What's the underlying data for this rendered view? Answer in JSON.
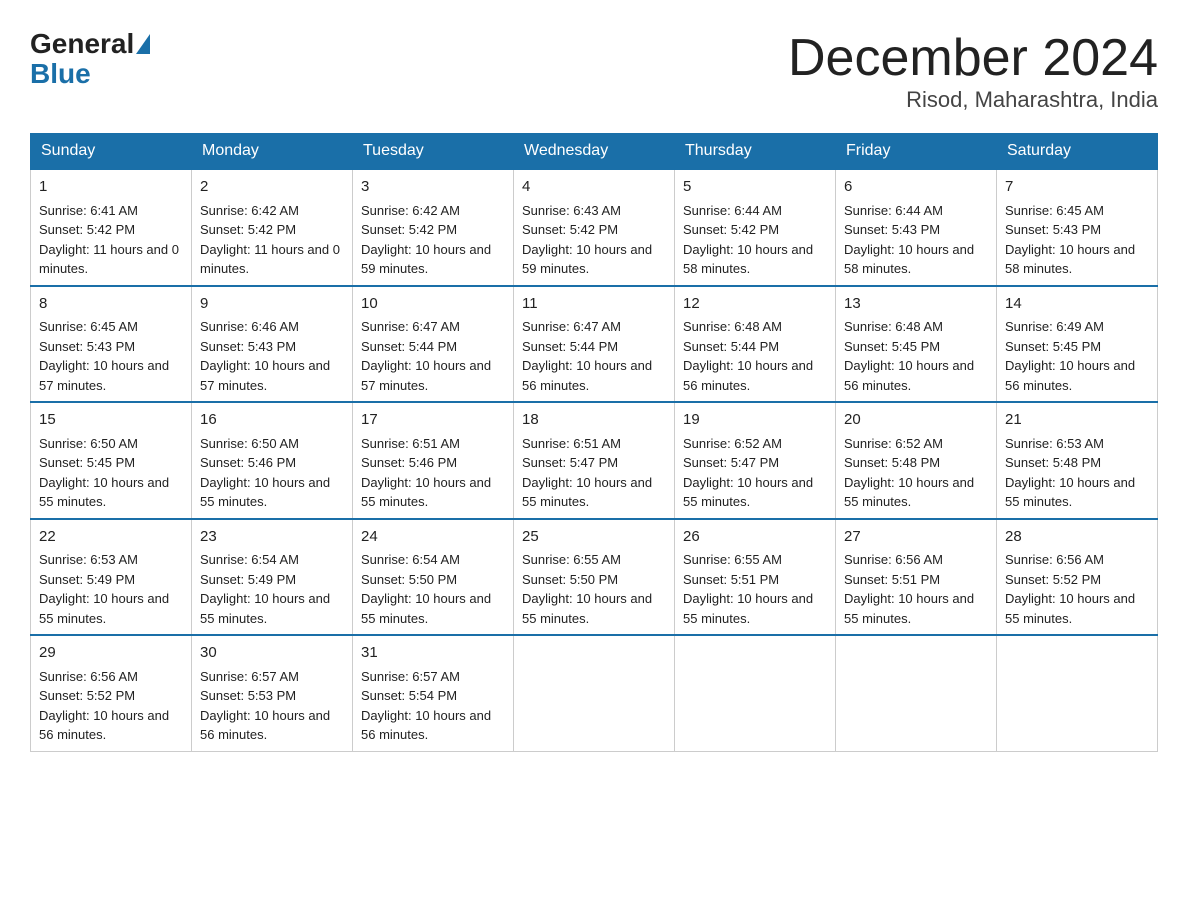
{
  "header": {
    "logo_general": "General",
    "logo_blue": "Blue",
    "month_title": "December 2024",
    "location": "Risod, Maharashtra, India"
  },
  "weekdays": [
    "Sunday",
    "Monday",
    "Tuesday",
    "Wednesday",
    "Thursday",
    "Friday",
    "Saturday"
  ],
  "weeks": [
    [
      {
        "day": "1",
        "sunrise": "6:41 AM",
        "sunset": "5:42 PM",
        "daylight": "11 hours and 0 minutes."
      },
      {
        "day": "2",
        "sunrise": "6:42 AM",
        "sunset": "5:42 PM",
        "daylight": "11 hours and 0 minutes."
      },
      {
        "day": "3",
        "sunrise": "6:42 AM",
        "sunset": "5:42 PM",
        "daylight": "10 hours and 59 minutes."
      },
      {
        "day": "4",
        "sunrise": "6:43 AM",
        "sunset": "5:42 PM",
        "daylight": "10 hours and 59 minutes."
      },
      {
        "day": "5",
        "sunrise": "6:44 AM",
        "sunset": "5:42 PM",
        "daylight": "10 hours and 58 minutes."
      },
      {
        "day": "6",
        "sunrise": "6:44 AM",
        "sunset": "5:43 PM",
        "daylight": "10 hours and 58 minutes."
      },
      {
        "day": "7",
        "sunrise": "6:45 AM",
        "sunset": "5:43 PM",
        "daylight": "10 hours and 58 minutes."
      }
    ],
    [
      {
        "day": "8",
        "sunrise": "6:45 AM",
        "sunset": "5:43 PM",
        "daylight": "10 hours and 57 minutes."
      },
      {
        "day": "9",
        "sunrise": "6:46 AM",
        "sunset": "5:43 PM",
        "daylight": "10 hours and 57 minutes."
      },
      {
        "day": "10",
        "sunrise": "6:47 AM",
        "sunset": "5:44 PM",
        "daylight": "10 hours and 57 minutes."
      },
      {
        "day": "11",
        "sunrise": "6:47 AM",
        "sunset": "5:44 PM",
        "daylight": "10 hours and 56 minutes."
      },
      {
        "day": "12",
        "sunrise": "6:48 AM",
        "sunset": "5:44 PM",
        "daylight": "10 hours and 56 minutes."
      },
      {
        "day": "13",
        "sunrise": "6:48 AM",
        "sunset": "5:45 PM",
        "daylight": "10 hours and 56 minutes."
      },
      {
        "day": "14",
        "sunrise": "6:49 AM",
        "sunset": "5:45 PM",
        "daylight": "10 hours and 56 minutes."
      }
    ],
    [
      {
        "day": "15",
        "sunrise": "6:50 AM",
        "sunset": "5:45 PM",
        "daylight": "10 hours and 55 minutes."
      },
      {
        "day": "16",
        "sunrise": "6:50 AM",
        "sunset": "5:46 PM",
        "daylight": "10 hours and 55 minutes."
      },
      {
        "day": "17",
        "sunrise": "6:51 AM",
        "sunset": "5:46 PM",
        "daylight": "10 hours and 55 minutes."
      },
      {
        "day": "18",
        "sunrise": "6:51 AM",
        "sunset": "5:47 PM",
        "daylight": "10 hours and 55 minutes."
      },
      {
        "day": "19",
        "sunrise": "6:52 AM",
        "sunset": "5:47 PM",
        "daylight": "10 hours and 55 minutes."
      },
      {
        "day": "20",
        "sunrise": "6:52 AM",
        "sunset": "5:48 PM",
        "daylight": "10 hours and 55 minutes."
      },
      {
        "day": "21",
        "sunrise": "6:53 AM",
        "sunset": "5:48 PM",
        "daylight": "10 hours and 55 minutes."
      }
    ],
    [
      {
        "day": "22",
        "sunrise": "6:53 AM",
        "sunset": "5:49 PM",
        "daylight": "10 hours and 55 minutes."
      },
      {
        "day": "23",
        "sunrise": "6:54 AM",
        "sunset": "5:49 PM",
        "daylight": "10 hours and 55 minutes."
      },
      {
        "day": "24",
        "sunrise": "6:54 AM",
        "sunset": "5:50 PM",
        "daylight": "10 hours and 55 minutes."
      },
      {
        "day": "25",
        "sunrise": "6:55 AM",
        "sunset": "5:50 PM",
        "daylight": "10 hours and 55 minutes."
      },
      {
        "day": "26",
        "sunrise": "6:55 AM",
        "sunset": "5:51 PM",
        "daylight": "10 hours and 55 minutes."
      },
      {
        "day": "27",
        "sunrise": "6:56 AM",
        "sunset": "5:51 PM",
        "daylight": "10 hours and 55 minutes."
      },
      {
        "day": "28",
        "sunrise": "6:56 AM",
        "sunset": "5:52 PM",
        "daylight": "10 hours and 55 minutes."
      }
    ],
    [
      {
        "day": "29",
        "sunrise": "6:56 AM",
        "sunset": "5:52 PM",
        "daylight": "10 hours and 56 minutes."
      },
      {
        "day": "30",
        "sunrise": "6:57 AM",
        "sunset": "5:53 PM",
        "daylight": "10 hours and 56 minutes."
      },
      {
        "day": "31",
        "sunrise": "6:57 AM",
        "sunset": "5:54 PM",
        "daylight": "10 hours and 56 minutes."
      },
      null,
      null,
      null,
      null
    ]
  ],
  "labels": {
    "sunrise_prefix": "Sunrise: ",
    "sunset_prefix": "Sunset: ",
    "daylight_prefix": "Daylight: "
  }
}
